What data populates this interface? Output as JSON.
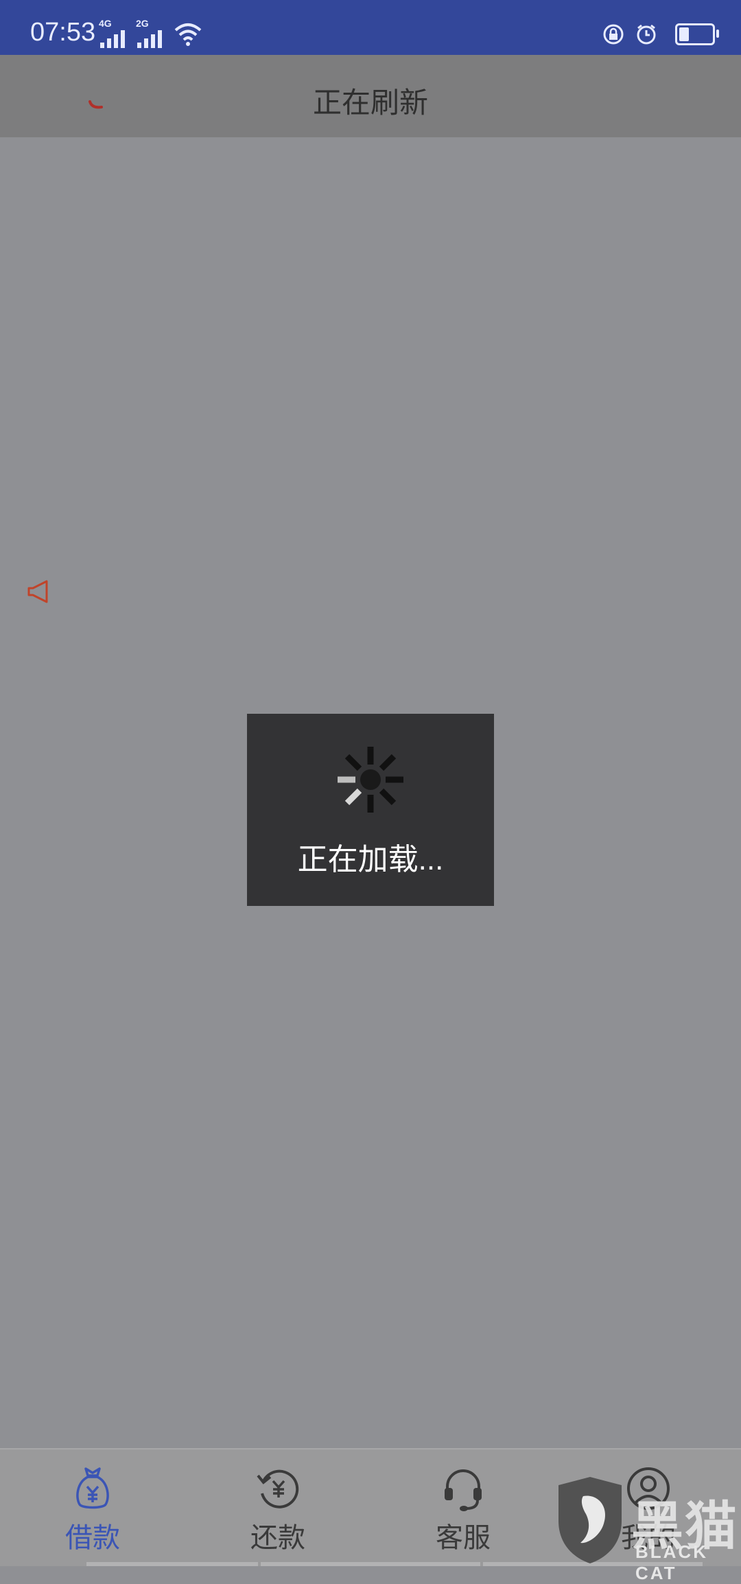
{
  "status_bar": {
    "time": "07:53",
    "network_1": "4G",
    "network_2": "2G",
    "icons": [
      "signal-icon",
      "signal-icon",
      "wifi-icon",
      "rotation-lock-icon",
      "alarm-icon",
      "battery-icon"
    ],
    "battery_level": 0.25
  },
  "header": {
    "title": "正在刷新"
  },
  "loading": {
    "text": "正在加载..."
  },
  "bottom_nav": {
    "items": [
      {
        "label": "借款",
        "icon": "money-bag-icon",
        "active": true
      },
      {
        "label": "还款",
        "icon": "repay-icon",
        "active": false
      },
      {
        "label": "客服",
        "icon": "headset-icon",
        "active": false
      },
      {
        "label": "我的",
        "icon": "user-icon",
        "active": false
      }
    ]
  },
  "watermark": {
    "cn": "黑猫",
    "en": "BLACK CAT"
  },
  "colors": {
    "status_bar": "#33479a",
    "header": "#7d7d7e",
    "overlay": "#8f9094",
    "accent": "#3b55b5",
    "dialog": "#333335",
    "speaker_icon": "#c0442a"
  }
}
